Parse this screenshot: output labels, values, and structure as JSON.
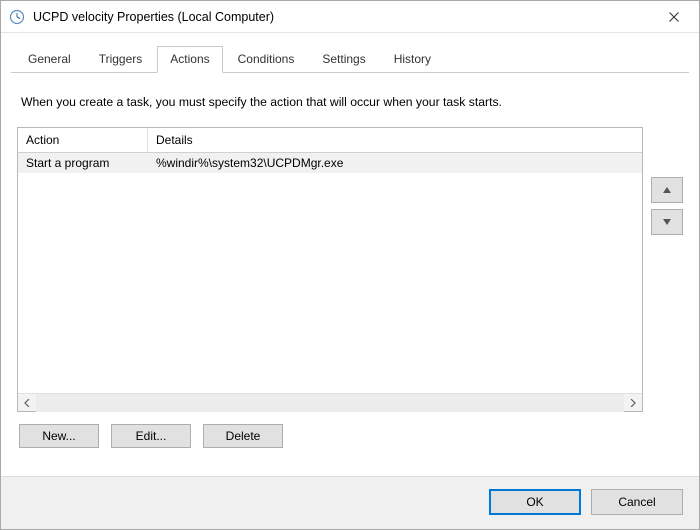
{
  "window": {
    "title": "UCPD velocity Properties (Local Computer)"
  },
  "tabs": [
    {
      "label": "General",
      "key": "general"
    },
    {
      "label": "Triggers",
      "key": "triggers"
    },
    {
      "label": "Actions",
      "key": "actions",
      "active": true
    },
    {
      "label": "Conditions",
      "key": "conditions"
    },
    {
      "label": "Settings",
      "key": "settings"
    },
    {
      "label": "History",
      "key": "history"
    }
  ],
  "actions_panel": {
    "description": "When you create a task, you must specify the action that will occur when your task starts.",
    "columns": {
      "action": "Action",
      "details": "Details"
    },
    "rows": [
      {
        "action": "Start a program",
        "details": "%windir%\\system32\\UCPDMgr.exe"
      }
    ],
    "buttons": {
      "new": "New...",
      "edit": "Edit...",
      "delete": "Delete"
    }
  },
  "footer": {
    "ok": "OK",
    "cancel": "Cancel"
  }
}
